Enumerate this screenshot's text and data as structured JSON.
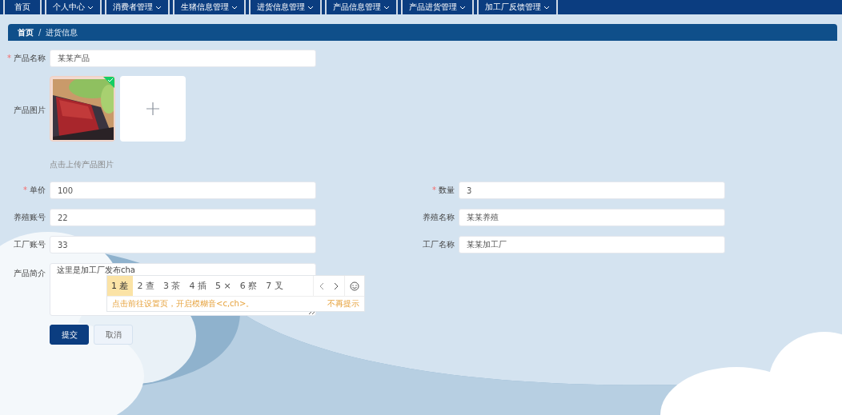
{
  "nav": {
    "items": [
      {
        "label": "首页",
        "dropdown": false
      },
      {
        "label": "个人中心",
        "dropdown": true
      },
      {
        "label": "消费者管理",
        "dropdown": true
      },
      {
        "label": "生猪信息管理",
        "dropdown": true
      },
      {
        "label": "进货信息管理",
        "dropdown": true
      },
      {
        "label": "产品信息管理",
        "dropdown": true
      },
      {
        "label": "产品进货管理",
        "dropdown": true
      },
      {
        "label": "加工厂反馈管理",
        "dropdown": true
      }
    ]
  },
  "breadcrumb": {
    "items": [
      "首页",
      "进货信息"
    ],
    "separator": "/"
  },
  "form": [
    {
      "kind": "input",
      "label": "产品名称",
      "required_mark": "*",
      "value": "某某产品"
    },
    {
      "kind": "upload",
      "label": "产品图片",
      "images": [
        {
          "kind": "picture",
          "uploaded": true
        }
      ],
      "hint": "点击上传产品图片"
    },
    {
      "kind": "pair",
      "fields": [
        {
          "label": "单价",
          "required_mark": "*",
          "value": "100"
        },
        {
          "label": "数量",
          "required_mark": "*",
          "value": "3"
        }
      ]
    },
    {
      "kind": "pair",
      "fields": [
        {
          "label": "养殖账号",
          "value": "22"
        },
        {
          "label": "养殖名称",
          "value": "某某养殖"
        }
      ]
    },
    {
      "kind": "pair",
      "fields": [
        {
          "label": "工厂账号",
          "value": "33"
        },
        {
          "label": "工厂名称",
          "value": "某某加工厂"
        }
      ]
    },
    {
      "kind": "textarea",
      "label": "产品简介",
      "value": "这里是加工厂发布cha"
    }
  ],
  "ime": {
    "candidates": [
      {
        "label": "1 差",
        "selected": true
      },
      {
        "label": "2 查",
        "selected": false
      },
      {
        "label": "3 茶",
        "selected": false
      },
      {
        "label": "4 插",
        "selected": false
      },
      {
        "label": "5 ×",
        "selected": false
      },
      {
        "label": "6 察",
        "selected": false
      },
      {
        "label": "7 叉",
        "selected": false
      }
    ],
    "hint": "点击前往设置页，开启模糊音<c,ch>。",
    "dismiss": "不再提示"
  },
  "buttons": [
    {
      "label": "提交",
      "kind": "primary"
    },
    {
      "label": "取消",
      "kind": "default"
    }
  ]
}
